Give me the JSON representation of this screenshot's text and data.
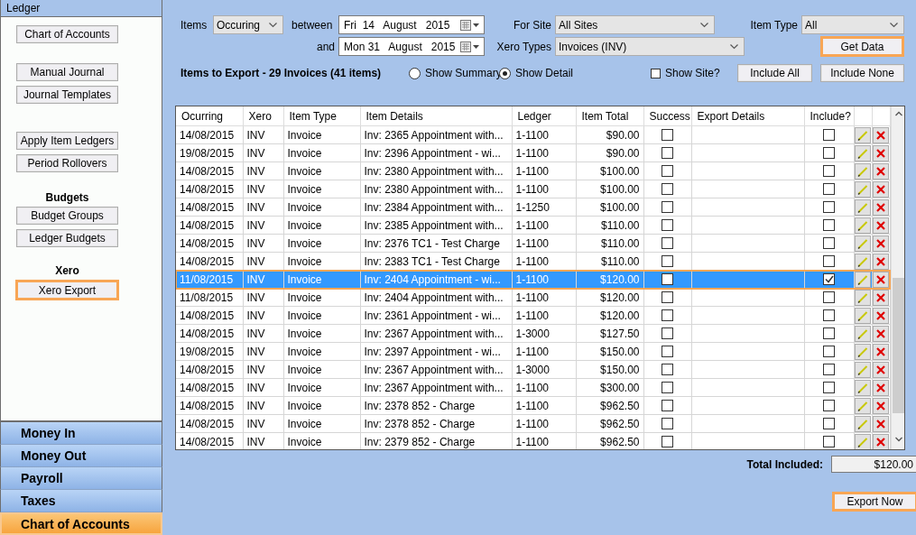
{
  "sidebar": {
    "title": "Ledger",
    "groups": [
      {
        "buttons": [
          {
            "label": "Chart of Accounts",
            "selected": false
          }
        ]
      },
      {
        "buttons": [
          {
            "label": "Manual Journal",
            "selected": false
          },
          {
            "label": "Journal Templates",
            "selected": false
          }
        ]
      },
      {
        "buttons": [
          {
            "label": "Apply Item Ledgers",
            "selected": false
          },
          {
            "label": "Period Rollovers",
            "selected": false
          }
        ]
      },
      {
        "heading": "Budgets",
        "buttons": [
          {
            "label": "Budget Groups",
            "selected": false
          },
          {
            "label": "Ledger Budgets",
            "selected": false
          }
        ]
      },
      {
        "heading": "Xero",
        "buttons": [
          {
            "label": "Xero Export",
            "selected": true
          }
        ]
      }
    ]
  },
  "nav": [
    {
      "label": "Money In",
      "selected": false
    },
    {
      "label": "Money Out",
      "selected": false
    },
    {
      "label": "Payroll",
      "selected": false
    },
    {
      "label": "Taxes",
      "selected": false
    },
    {
      "label": "Chart of Accounts",
      "selected": true
    }
  ],
  "filters": {
    "items_label": "Items",
    "items_value": "Occuring",
    "between_label": "between",
    "from_date": "Fri  14   August   2015",
    "and_label": "and",
    "to_date": "Mon 31   August   2015",
    "site_label": "For Site",
    "site_value": "All Sites",
    "item_type_label": "Item Type",
    "item_type_value": "All",
    "xero_types_label": "Xero Types",
    "xero_types_value": "Invoices (INV)",
    "get_data": {
      "label": "Get Data",
      "highlighted": true
    }
  },
  "summary": {
    "title": "Items to Export - 29 Invoices (41 items)",
    "views": [
      {
        "label": "Show Summary",
        "selected": false
      },
      {
        "label": "Show Detail",
        "selected": true
      }
    ],
    "show_site": {
      "label": "Show Site?",
      "checked": false
    },
    "include_all": "Include All",
    "include_none": "Include None"
  },
  "grid": {
    "columns": [
      "Ocurring",
      "Xero",
      "Item Type",
      "Item Details",
      "Ledger",
      "Item Total",
      "Success",
      "Export Details",
      "Include?"
    ],
    "rows": [
      {
        "date": "14/08/2015",
        "xero": "INV",
        "type": "Invoice",
        "details": "Inv: 2365 Appointment with...",
        "ledger": "1-1100",
        "total": "$90.00",
        "success": false,
        "include": false,
        "selected": false
      },
      {
        "date": "19/08/2015",
        "xero": "INV",
        "type": "Invoice",
        "details": "Inv: 2396 Appointment -  wi...",
        "ledger": "1-1100",
        "total": "$90.00",
        "success": false,
        "include": false,
        "selected": false
      },
      {
        "date": "14/08/2015",
        "xero": "INV",
        "type": "Invoice",
        "details": "Inv: 2380 Appointment with...",
        "ledger": "1-1100",
        "total": "$100.00",
        "success": false,
        "include": false,
        "selected": false
      },
      {
        "date": "14/08/2015",
        "xero": "INV",
        "type": "Invoice",
        "details": "Inv: 2380 Appointment with...",
        "ledger": "1-1100",
        "total": "$100.00",
        "success": false,
        "include": false,
        "selected": false
      },
      {
        "date": "14/08/2015",
        "xero": "INV",
        "type": "Invoice",
        "details": "Inv: 2384 Appointment with...",
        "ledger": "1-1250",
        "total": "$100.00",
        "success": false,
        "include": false,
        "selected": false
      },
      {
        "date": "14/08/2015",
        "xero": "INV",
        "type": "Invoice",
        "details": "Inv: 2385 Appointment with...",
        "ledger": "1-1100",
        "total": "$110.00",
        "success": false,
        "include": false,
        "selected": false
      },
      {
        "date": "14/08/2015",
        "xero": "INV",
        "type": "Invoice",
        "details": "Inv: 2376 TC1 - Test Charge",
        "ledger": "1-1100",
        "total": "$110.00",
        "success": false,
        "include": false,
        "selected": false
      },
      {
        "date": "14/08/2015",
        "xero": "INV",
        "type": "Invoice",
        "details": "Inv: 2383 TC1 - Test Charge",
        "ledger": "1-1100",
        "total": "$110.00",
        "success": false,
        "include": false,
        "selected": false
      },
      {
        "date": "11/08/2015",
        "xero": "INV",
        "type": "Invoice",
        "details": "Inv: 2404 Appointment -  wi...",
        "ledger": "1-1100",
        "total": "$120.00",
        "success": false,
        "include": true,
        "selected": true
      },
      {
        "date": "11/08/2015",
        "xero": "INV",
        "type": "Invoice",
        "details": "Inv: 2404 Appointment with...",
        "ledger": "1-1100",
        "total": "$120.00",
        "success": false,
        "include": false,
        "selected": false
      },
      {
        "date": "14/08/2015",
        "xero": "INV",
        "type": "Invoice",
        "details": "Inv: 2361 Appointment -  wi...",
        "ledger": "1-1100",
        "total": "$120.00",
        "success": false,
        "include": false,
        "selected": false
      },
      {
        "date": "14/08/2015",
        "xero": "INV",
        "type": "Invoice",
        "details": "Inv: 2367 Appointment with...",
        "ledger": "1-3000",
        "total": "$127.50",
        "success": false,
        "include": false,
        "selected": false
      },
      {
        "date": "19/08/2015",
        "xero": "INV",
        "type": "Invoice",
        "details": "Inv: 2397 Appointment -  wi...",
        "ledger": "1-1100",
        "total": "$150.00",
        "success": false,
        "include": false,
        "selected": false
      },
      {
        "date": "14/08/2015",
        "xero": "INV",
        "type": "Invoice",
        "details": "Inv: 2367 Appointment with...",
        "ledger": "1-3000",
        "total": "$150.00",
        "success": false,
        "include": false,
        "selected": false
      },
      {
        "date": "14/08/2015",
        "xero": "INV",
        "type": "Invoice",
        "details": "Inv: 2367 Appointment with...",
        "ledger": "1-1100",
        "total": "$300.00",
        "success": false,
        "include": false,
        "selected": false
      },
      {
        "date": "14/08/2015",
        "xero": "INV",
        "type": "Invoice",
        "details": "Inv: 2378 852 - Charge",
        "ledger": "1-1100",
        "total": "$962.50",
        "success": false,
        "include": false,
        "selected": false
      },
      {
        "date": "14/08/2015",
        "xero": "INV",
        "type": "Invoice",
        "details": "Inv: 2378 852 - Charge",
        "ledger": "1-1100",
        "total": "$962.50",
        "success": false,
        "include": false,
        "selected": false
      },
      {
        "date": "14/08/2015",
        "xero": "INV",
        "type": "Invoice",
        "details": "Inv: 2379 852 - Charge",
        "ledger": "1-1100",
        "total": "$962.50",
        "success": false,
        "include": false,
        "selected": false
      }
    ]
  },
  "footer": {
    "total_label": "Total Included:",
    "total_value": "$120.00",
    "export": {
      "label": "Export Now",
      "highlighted": true
    }
  }
}
